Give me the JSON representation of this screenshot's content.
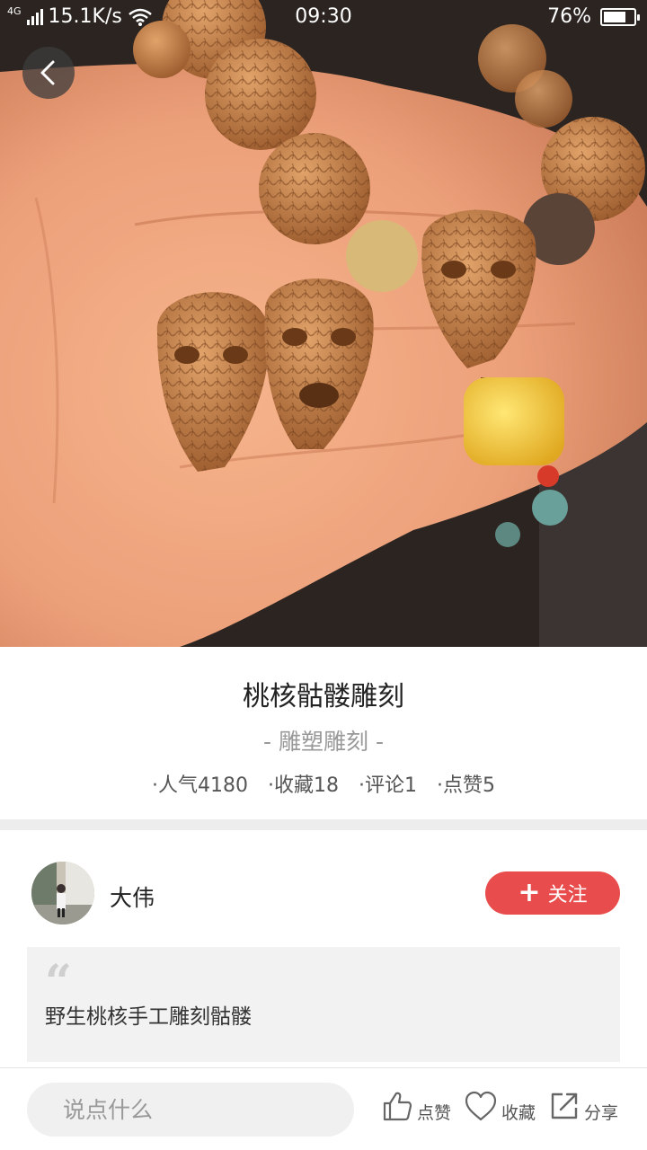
{
  "status_bar": {
    "network_type": "4G",
    "speed": "15.1K/s",
    "time": "09:30",
    "battery_percent": "76%",
    "battery_level": 0.76
  },
  "header": {
    "back_icon": "chevron-left-icon"
  },
  "hero_image": {
    "subject": "carved peach-pit skull beads bracelet held in palm"
  },
  "item": {
    "title": "桃核骷髅雕刻",
    "category": "- 雕塑雕刻 -",
    "stats": [
      {
        "text": "·人气4180"
      },
      {
        "text": "·收藏18"
      },
      {
        "text": "·评论1"
      },
      {
        "text": "·点赞5"
      }
    ]
  },
  "author": {
    "name": "大伟",
    "follow_label": "关注"
  },
  "description": {
    "quote_icon": "quote-icon",
    "text": "野生桃核手工雕刻骷髅"
  },
  "bottom_bar": {
    "comment_placeholder": "说点什么",
    "actions": [
      {
        "label": "点赞",
        "icon": "thumbs-up-icon"
      },
      {
        "label": "收藏",
        "icon": "heart-icon"
      },
      {
        "label": "分享",
        "icon": "share-icon"
      }
    ]
  },
  "colors": {
    "accent": "#e84c4c",
    "divider": "#ededed",
    "quote_bg": "#f2f2f2"
  }
}
